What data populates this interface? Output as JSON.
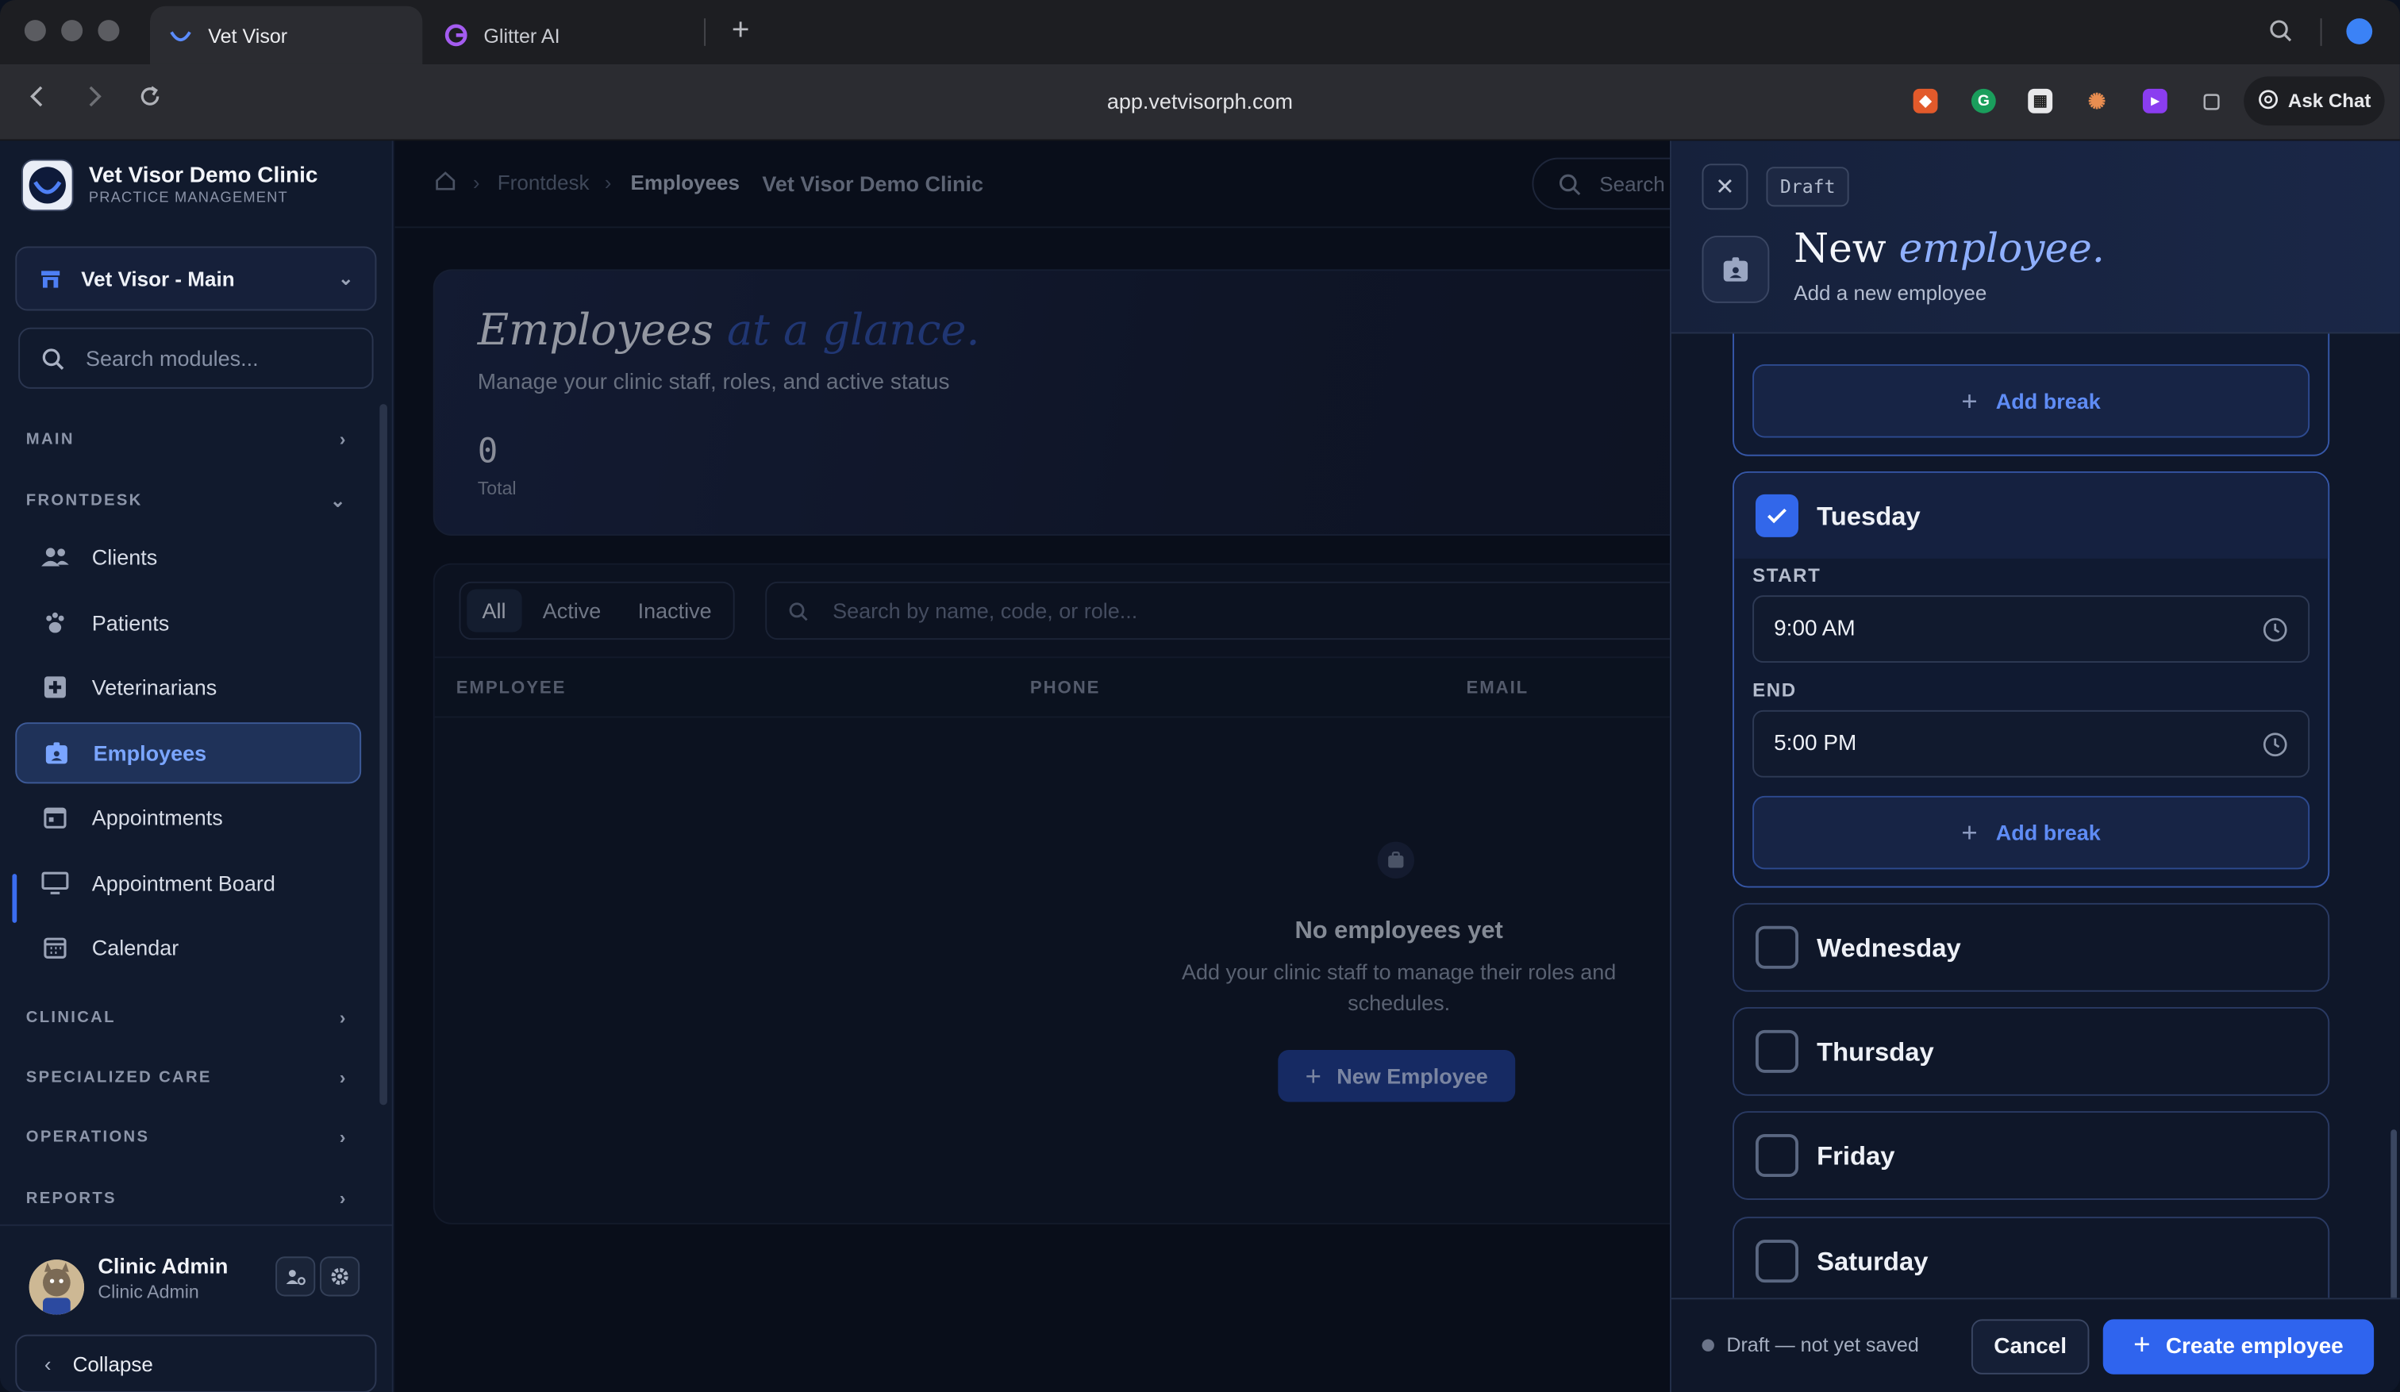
{
  "browser": {
    "tabs": [
      {
        "label": "Vet Visor",
        "icon": "vetvisor-logo-icon",
        "active": true
      },
      {
        "label": "Glitter AI",
        "icon": "glitter-ai-icon",
        "active": false
      }
    ],
    "url": "app.vetvisorph.com",
    "ask_chat": "Ask Chat"
  },
  "sidebar": {
    "brand_name": "Vet Visor Demo Clinic",
    "brand_sub": "PRACTICE MANAGEMENT",
    "branch": "Vet Visor - Main",
    "search_placeholder": "Search modules...",
    "sections": {
      "main": "MAIN",
      "frontdesk": "FRONTDESK",
      "clinical": "CLINICAL",
      "specialized": "SPECIALIZED CARE",
      "operations": "OPERATIONS",
      "reports": "REPORTS"
    },
    "items": [
      {
        "label": "Clients",
        "icon": "users-icon"
      },
      {
        "label": "Patients",
        "icon": "paw-icon"
      },
      {
        "label": "Veterinarians",
        "icon": "medical-cross-icon"
      },
      {
        "label": "Employees",
        "icon": "id-badge-icon",
        "active": true
      },
      {
        "label": "Appointments",
        "icon": "calendar-icon"
      },
      {
        "label": "Appointment Board",
        "icon": "monitor-icon"
      },
      {
        "label": "Calendar",
        "icon": "calendar-grid-icon"
      }
    ],
    "user": {
      "name": "Clinic Admin",
      "role": "Clinic Admin"
    },
    "collapse": "Collapse"
  },
  "main": {
    "breadcrumb": {
      "home_icon": "home-icon",
      "frontdesk": "Frontdesk",
      "employees": "Employees",
      "clinic": "Vet Visor Demo Clinic"
    },
    "search_placeholder": "Search",
    "hero": {
      "title_main": "Employees",
      "title_accent": "at a glance.",
      "description": "Manage your clinic staff, roles, and active status",
      "total_value": "0",
      "total_label": "Total"
    },
    "filters": [
      "All",
      "Active",
      "Inactive"
    ],
    "table_search_placeholder": "Search by name, code, or role...",
    "columns": [
      "EMPLOYEE",
      "PHONE",
      "EMAIL"
    ],
    "empty": {
      "title": "No employees yet",
      "description": "Add your clinic staff to manage their roles and schedules.",
      "button": "New Employee"
    }
  },
  "drawer": {
    "badge": "Draft",
    "title_main": "New",
    "title_accent": "employee.",
    "subtitle": "Add a new employee",
    "add_break": "Add break",
    "days": [
      {
        "name": "Tuesday",
        "checked": true,
        "start_label": "START",
        "start": "9:00 AM",
        "end_label": "END",
        "end": "5:00 PM"
      },
      {
        "name": "Wednesday",
        "checked": false
      },
      {
        "name": "Thursday",
        "checked": false
      },
      {
        "name": "Friday",
        "checked": false
      },
      {
        "name": "Saturday",
        "checked": false
      }
    ],
    "footer_status": "Draft — not yet saved",
    "cancel": "Cancel",
    "create": "Create employee"
  },
  "colors": {
    "accent": "#2f64ee",
    "active_nav": "#7aa5ff",
    "background": "#0b1220"
  }
}
